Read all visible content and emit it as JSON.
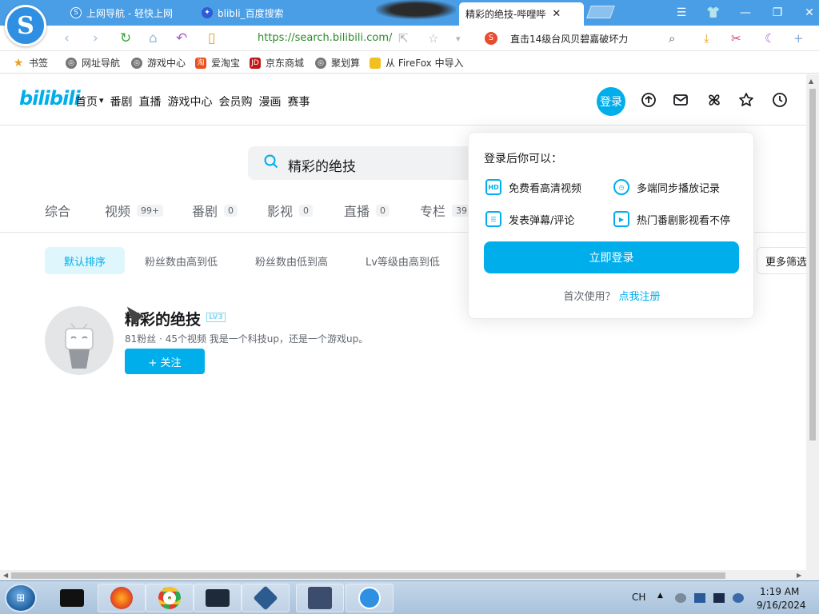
{
  "browser": {
    "tabs": [
      {
        "title": "上网导航 - 轻快上网",
        "active": false
      },
      {
        "title": "blibli_百度搜索",
        "active": false
      },
      {
        "title": "精彩的绝技-哔哩哔",
        "active": true
      }
    ],
    "url": "https://search.bilibili.com/",
    "news_text": "直击14级台风贝碧嘉破坏力",
    "news_badge": "S",
    "bookmarks": [
      "书签",
      "网址导航",
      "游戏中心",
      "爱淘宝",
      "京东商城",
      "聚划算",
      "从 FireFox 中导入"
    ],
    "colors": {
      "tabbar": "#4a9ee6",
      "accent": "#00aeec"
    }
  },
  "bili": {
    "logo": "bilibili",
    "nav": [
      "首页",
      "番剧",
      "直播",
      "游戏中心",
      "会员购",
      "漫画",
      "赛事"
    ],
    "login_label": "登录",
    "header_icons": [
      "vip-icon",
      "message-icon",
      "dynamic-icon",
      "favorite-icon",
      "history-icon"
    ],
    "search_value": "精彩的绝技",
    "type_tabs": [
      {
        "label": "综合",
        "count": ""
      },
      {
        "label": "视频",
        "count": "99+"
      },
      {
        "label": "番剧",
        "count": "0"
      },
      {
        "label": "影视",
        "count": "0"
      },
      {
        "label": "直播",
        "count": "0"
      },
      {
        "label": "专栏",
        "count": "39"
      }
    ],
    "sorts": [
      "默认排序",
      "粉丝数由高到低",
      "粉丝数由低到高",
      "Lv等级由高到低"
    ],
    "more_filter": "更多筛选",
    "user": {
      "name": "精彩的绝技",
      "level": "LV3",
      "meta": "81粉丝 · 45个视频  我是一个科技up，还是一个游戏up。",
      "follow": "+ 关注"
    },
    "popup": {
      "title": "登录后你可以：",
      "benefits": [
        "免费看高清视频",
        "多端同步播放记录",
        "发表弹幕/评论",
        "热门番剧影视看不停"
      ],
      "login_button": "立即登录",
      "first_use": "首次使用？",
      "register": "点我注册"
    }
  },
  "taskbar": {
    "lang": "CH",
    "time": "1:19 AM",
    "date": "9/16/2024"
  }
}
